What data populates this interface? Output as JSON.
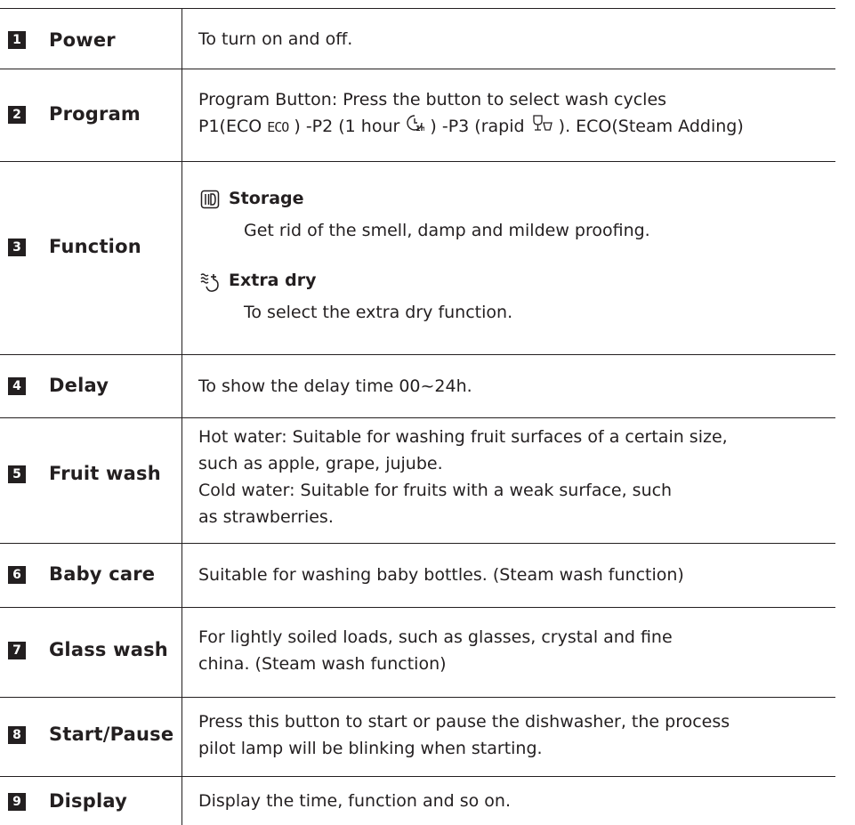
{
  "rows": [
    {
      "num": "1",
      "label": "Power",
      "desc": [
        "To turn on and off."
      ]
    },
    {
      "num": "2",
      "label": "Program",
      "desc_line1": "Program Button: Press the button to select wash cycles",
      "desc_line2": {
        "a": "P1(ECO ",
        "eco_mark": "ECO",
        "b": " ) -P2 (1 hour ",
        "c": " ) -P3 (rapid ",
        "d": " ).  ECO(Steam Adding)"
      }
    },
    {
      "num": "3",
      "label": "Function",
      "items": [
        {
          "icon": "storage-icon",
          "title": "Storage",
          "text": "Get rid of the smell, damp and mildew proofing."
        },
        {
          "icon": "extra-dry-icon",
          "title": "Extra dry",
          "text": "To select the extra dry function."
        }
      ]
    },
    {
      "num": "4",
      "label": "Delay",
      "desc": [
        "To show the delay time 00~24h."
      ]
    },
    {
      "num": "5",
      "label": "Fruit wash",
      "desc": [
        "Hot water: Suitable for washing fruit surfaces of a certain size,",
        "such as apple, grape, jujube.",
        "Cold water: Suitable for fruits with a weak surface, such",
        "as strawberries."
      ]
    },
    {
      "num": "6",
      "label": "Baby care",
      "desc": [
        "Suitable for washing baby bottles. (Steam wash function)"
      ]
    },
    {
      "num": "7",
      "label": "Glass wash",
      "desc": [
        "For lightly soiled loads, such as glasses, crystal and fine",
        "china. (Steam wash function)"
      ]
    },
    {
      "num": "8",
      "label": "Start/Pause",
      "desc": [
        "Press this button to start or pause the dishwasher, the process",
        "pilot lamp will be blinking when starting."
      ]
    },
    {
      "num": "9",
      "label": "Display",
      "desc": [
        "Display the time, function and so on."
      ]
    }
  ],
  "icons": {
    "one_hour_icon": "1h-clock-icon",
    "rapid_icon": "rapid-glass-icon",
    "one_hour_text": "1h"
  }
}
